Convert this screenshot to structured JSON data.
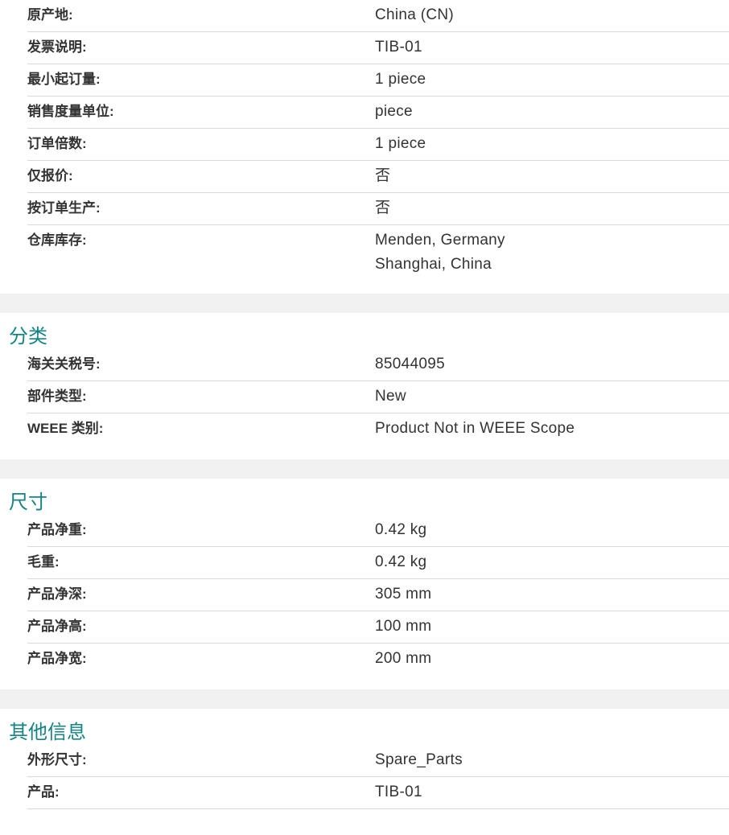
{
  "general": {
    "rows": [
      {
        "label": "原产地:",
        "value": "China (CN)"
      },
      {
        "label": "发票说明:",
        "value": "TIB-01"
      },
      {
        "label": "最小起订量:",
        "value": "1 piece"
      },
      {
        "label": "销售度量单位:",
        "value": "piece"
      },
      {
        "label": "订单倍数:",
        "value": "1 piece"
      },
      {
        "label": "仅报价:",
        "value": "否"
      },
      {
        "label": "按订单生产:",
        "value": "否"
      },
      {
        "label": "仓库库存:",
        "values": [
          "Menden, Germany",
          "Shanghai, China"
        ]
      }
    ]
  },
  "classification": {
    "title": "分类",
    "rows": [
      {
        "label": "海关关税号:",
        "value": "85044095"
      },
      {
        "label": "部件类型:",
        "value": "New"
      },
      {
        "label": "WEEE 类别:",
        "value": "Product Not in WEEE Scope"
      }
    ]
  },
  "dimensions": {
    "title": "尺寸",
    "rows": [
      {
        "label": "产品净重:",
        "value": "0.42 kg"
      },
      {
        "label": "毛重:",
        "value": "0.42 kg"
      },
      {
        "label": "产品净深:",
        "value": "305 mm"
      },
      {
        "label": "产品净高:",
        "value": "100 mm"
      },
      {
        "label": "产品净宽:",
        "value": "200 mm"
      }
    ]
  },
  "other": {
    "title": "其他信息",
    "rows": [
      {
        "label": "外形尺寸:",
        "value": "Spare_Parts"
      },
      {
        "label": "产品:",
        "value": "TIB-01"
      }
    ]
  },
  "colors": {
    "section_title": "#138483",
    "gap_background": "#f1f1f1",
    "divider": "#d9d9d9",
    "text": "#333333"
  }
}
